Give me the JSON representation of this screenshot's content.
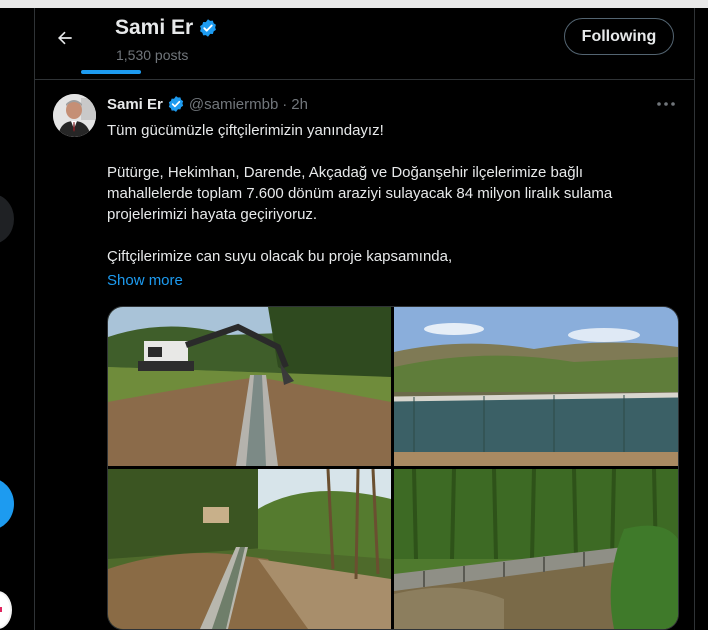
{
  "header": {
    "back_icon": "arrow-left-icon",
    "name": "Sami Er",
    "verified_icon": "verified-badge-icon",
    "post_count": "1,530 posts",
    "follow_label": "Following"
  },
  "tweet": {
    "author_name": "Sami Er",
    "handle": "@samiermbb",
    "separator": "·",
    "time": "2h",
    "more_icon": "more-options-icon",
    "text": {
      "line1": "Tüm gücümüzle çiftçilerimizin yanındayız!",
      "para2": "Pütürge, Hekimhan, Darende, Akçadağ ve Doğanşehir ilçelerimize bağlı mahallelerde toplam 7.600 dönüm araziyi sulayacak 84 milyon liralık sulama projelerimizi hayata geçiriyoruz.",
      "para3": "Çiftçilerimize can suyu olacak bu proje kapsamında,"
    },
    "show_more": "Show more"
  },
  "colors": {
    "background": "#000000",
    "text": "#e7e9ea",
    "muted": "#71767b",
    "accent": "#1d9bf0",
    "border": "#2f3336"
  }
}
